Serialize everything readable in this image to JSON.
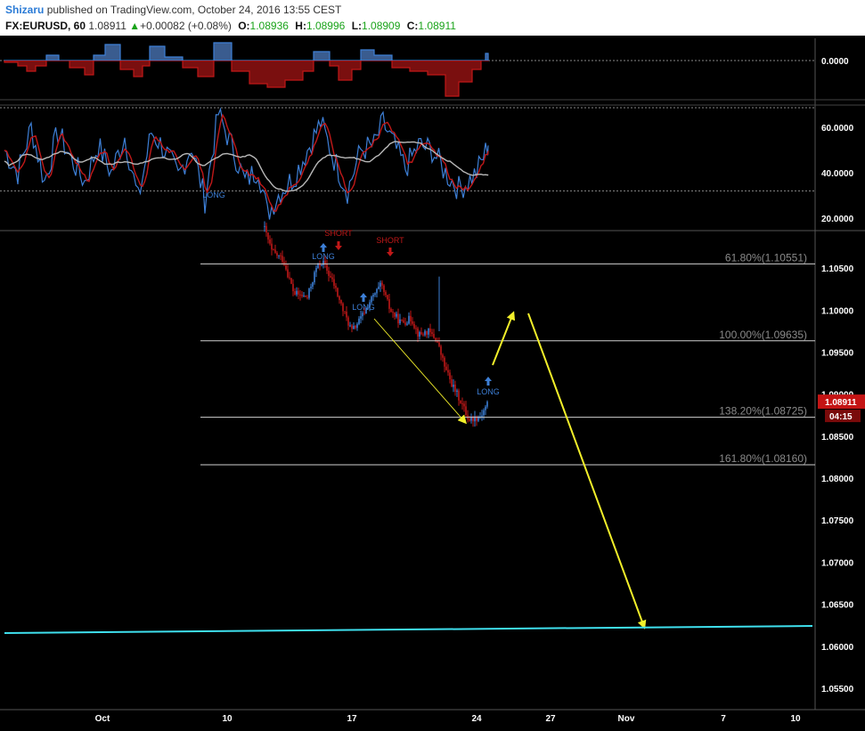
{
  "header": {
    "author": "Shizaru",
    "published_text": "published on TradingView.com, October 24, 2016 13:55 CEST",
    "symbol": "FX:EURUSD, 60",
    "last": "1.08911",
    "change": "+0.00082 (+0.08%)",
    "o_label": "O:",
    "o_value": "1.08936",
    "h_label": "H:",
    "h_value": "1.08996",
    "l_label": "L:",
    "l_value": "1.08909",
    "c_label": "C:",
    "c_value": "1.08911"
  },
  "colors": {
    "background": "#000000",
    "bull": "#3d7fd6",
    "bear": "#c01818",
    "arrow": "#f2ef2a",
    "trendline": "#3fe0ee",
    "fib_line": "#d0d0d0",
    "fib_label": "#8a8a8a",
    "axis_text": "#ffffff",
    "price_tag": "#c41414"
  },
  "chart_data": {
    "type": "candlestick",
    "price_axis": {
      "ticks": [
        "1.10500",
        "1.10000",
        "1.09500",
        "1.09000",
        "1.08500",
        "1.08000",
        "1.07500",
        "1.07000",
        "1.06500",
        "1.06000",
        "1.05500"
      ],
      "ylim": [
        1.053,
        1.11
      ]
    },
    "time_axis": {
      "ticks": [
        "Oct",
        "10",
        "17",
        "24",
        "27",
        "Nov",
        "7",
        "10"
      ]
    },
    "current_price": "1.08911",
    "countdown": "04:15",
    "osc1": {
      "ticks": [
        "0.0000"
      ]
    },
    "osc2": {
      "ticks": [
        "60.0000",
        "40.0000",
        "20.0000"
      ]
    },
    "fib_levels": [
      {
        "label": "61.80%(1.10551)",
        "price": 1.10551
      },
      {
        "label": "100.00%(1.09635)",
        "price": 1.09635
      },
      {
        "label": "138.20%(1.08725)",
        "price": 1.08725
      },
      {
        "label": "161.80%(1.08160)",
        "price": 1.0816
      }
    ],
    "signals": [
      {
        "text": "LONG",
        "type": "long"
      },
      {
        "text": "SHORT",
        "type": "short"
      },
      {
        "text": "LONG",
        "type": "long"
      },
      {
        "text": "SHORT",
        "type": "short"
      },
      {
        "text": "LONG",
        "type": "long"
      },
      {
        "text": "LONG",
        "type": "long"
      }
    ]
  }
}
